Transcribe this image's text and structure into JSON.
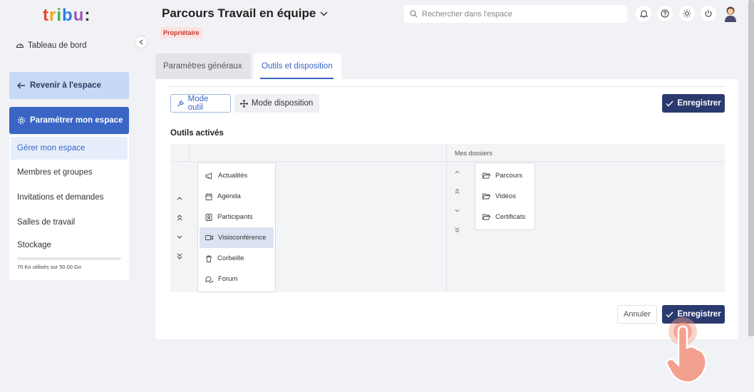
{
  "sidebar": {
    "logo": "tribu:",
    "dashboard_label": "Tableau de bord",
    "back_label": "Revenir à l'espace",
    "settings_label": "Paramétrer mon espace",
    "menu": [
      {
        "label": "Gérer mon espace",
        "active": true
      },
      {
        "label": "Membres et groupes"
      },
      {
        "label": "Invitations et demandes"
      },
      {
        "label": "Salles de travail"
      },
      {
        "label": "Stockage"
      }
    ],
    "storage_text": "70 Ko utilisés sur 50.00 Go"
  },
  "header": {
    "title": "Parcours Travail en équipe",
    "badge": "Propriétaire",
    "search_placeholder": "Rechercher dans l'espace",
    "icons": [
      "bell-icon",
      "help-icon",
      "theme-icon",
      "power-icon",
      "avatar"
    ]
  },
  "tabs": [
    {
      "label": "Paramètres généraux",
      "active": false
    },
    {
      "label": "Outils et disposition",
      "active": true
    }
  ],
  "toolbar": {
    "mode_tool": "Mode outil",
    "mode_layout": "Mode disposition",
    "save": "Enregistrer"
  },
  "section_title": "Outils activés",
  "tools": [
    {
      "label": "Actualités",
      "icon": "megaphone-icon"
    },
    {
      "label": "Agenda",
      "icon": "calendar-icon"
    },
    {
      "label": "Participants",
      "icon": "contact-icon"
    },
    {
      "label": "Visioconférence",
      "icon": "video-icon",
      "selected": true
    },
    {
      "label": "Corbeille",
      "icon": "trash-icon"
    },
    {
      "label": "Forum",
      "icon": "chat-icon"
    }
  ],
  "folders_header": "Mes dossiers",
  "folders": [
    {
      "label": "Parcours",
      "icon": "folder-icon"
    },
    {
      "label": "Vidéos",
      "icon": "folder-icon"
    },
    {
      "label": "Certificats",
      "icon": "folder-icon"
    }
  ],
  "footer": {
    "cancel": "Annuler",
    "save": "Enregistrer"
  },
  "colors": {
    "accent": "#3a65c4",
    "primary_dark": "#2b3a6e",
    "badge_bg": "#fde2e2",
    "badge_text": "#c0392b"
  }
}
